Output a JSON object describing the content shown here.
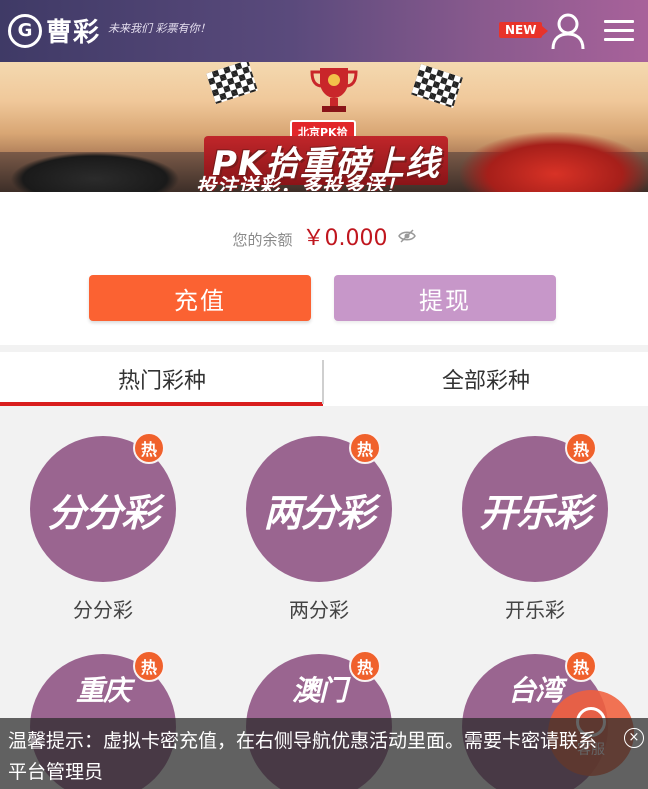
{
  "header": {
    "logo_mark": "G",
    "logo_text": "曹彩",
    "logo_slogan": "未来我们 彩票有你！",
    "new_badge": "NEW",
    "user_icon": "user-icon",
    "menu_icon": "hamburger-menu-icon"
  },
  "banner": {
    "tag": "北京PK拾",
    "title": "PK拾重磅上线",
    "subtitle": "投注送彩，多投多送！"
  },
  "balance": {
    "label": "您的余额",
    "value": "￥0.000",
    "eye_icon": "eye-hidden-icon"
  },
  "actions": {
    "recharge": "充值",
    "withdraw": "提现"
  },
  "tabs": [
    {
      "label": "热门彩种",
      "active": true
    },
    {
      "label": "全部彩种",
      "active": false
    }
  ],
  "games": [
    {
      "name": "分分彩",
      "logo": "分分彩",
      "badge": "热"
    },
    {
      "name": "两分彩",
      "logo": "两分彩",
      "badge": "热"
    },
    {
      "name": "开乐彩",
      "logo": "开乐彩",
      "badge": "热"
    },
    {
      "name": "",
      "logo": "重庆",
      "badge": "热"
    },
    {
      "name": "",
      "logo": "澳门",
      "badge": "热"
    },
    {
      "name": "",
      "logo": "台湾",
      "badge": "热"
    }
  ],
  "float_button": {
    "label": "客服"
  },
  "notice": {
    "text": "温馨提示：虚拟卡密充值，在右侧导航优惠活动里面。需要卡密请联系平台管理员",
    "close_icon": "close-circle-icon"
  },
  "colors": {
    "accent_orange": "#fb6232",
    "accent_purple": "#c797c9",
    "game_circle": "#9a6590",
    "hot_badge": "#f0612c",
    "tab_underline": "#d91e1e",
    "balance_red": "#c0161e"
  }
}
